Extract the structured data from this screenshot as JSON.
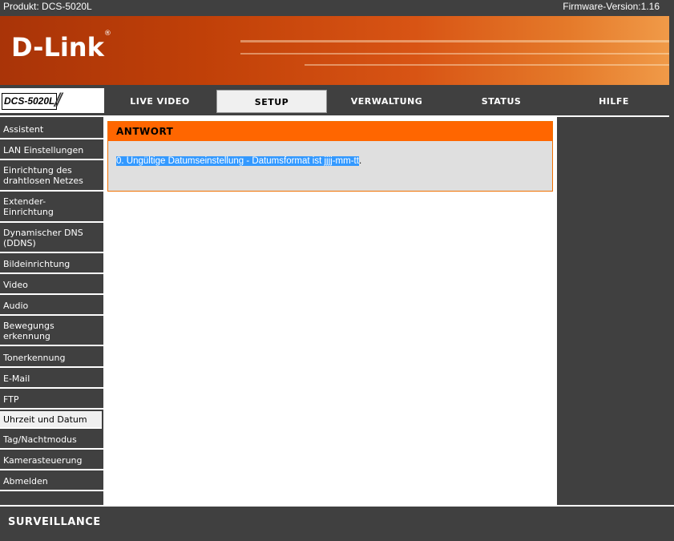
{
  "topbar": {
    "product": "Produkt: DCS-5020L",
    "firmware": "Firmware-Version:1.16"
  },
  "brand": {
    "logo": "D-Link",
    "trademark": "®",
    "model": "DCS-5020L",
    "footer": "SURVEILLANCE"
  },
  "nav": {
    "tabs": [
      {
        "label": "LIVE VIDEO",
        "active": false
      },
      {
        "label": "SETUP",
        "active": true
      },
      {
        "label": "VERWALTUNG",
        "active": false
      },
      {
        "label": "STATUS",
        "active": false
      },
      {
        "label": "HILFE",
        "active": false
      }
    ]
  },
  "sidebar": {
    "items": [
      {
        "label": "Assistent"
      },
      {
        "label": "LAN Einstellungen"
      },
      {
        "label": "Einrichtung des drahtlosen Netzes"
      },
      {
        "label": "Extender-Einrichtung"
      },
      {
        "label": "Dynamischer DNS (DDNS)"
      },
      {
        "label": "Bildeinrichtung"
      },
      {
        "label": "Video"
      },
      {
        "label": "Audio"
      },
      {
        "label": "Bewegungs erkennung"
      },
      {
        "label": "Tonerkennung"
      },
      {
        "label": "E-Mail"
      },
      {
        "label": "FTP"
      },
      {
        "label": "Uhrzeit und Datum",
        "active": true
      },
      {
        "label": "Tag/Nachtmodus"
      },
      {
        "label": "Kamerasteuerung"
      },
      {
        "label": "Abmelden"
      }
    ]
  },
  "response": {
    "title": "ANTWORT",
    "message": "0. Ungültige Datumseinstellung - Datumsformat ist jjjj-mm-tt",
    "message_end": "."
  },
  "colors": {
    "accent": "#ff6600",
    "dark": "#404040",
    "panel": "#dfdfdf",
    "selection": "#3399ff"
  }
}
